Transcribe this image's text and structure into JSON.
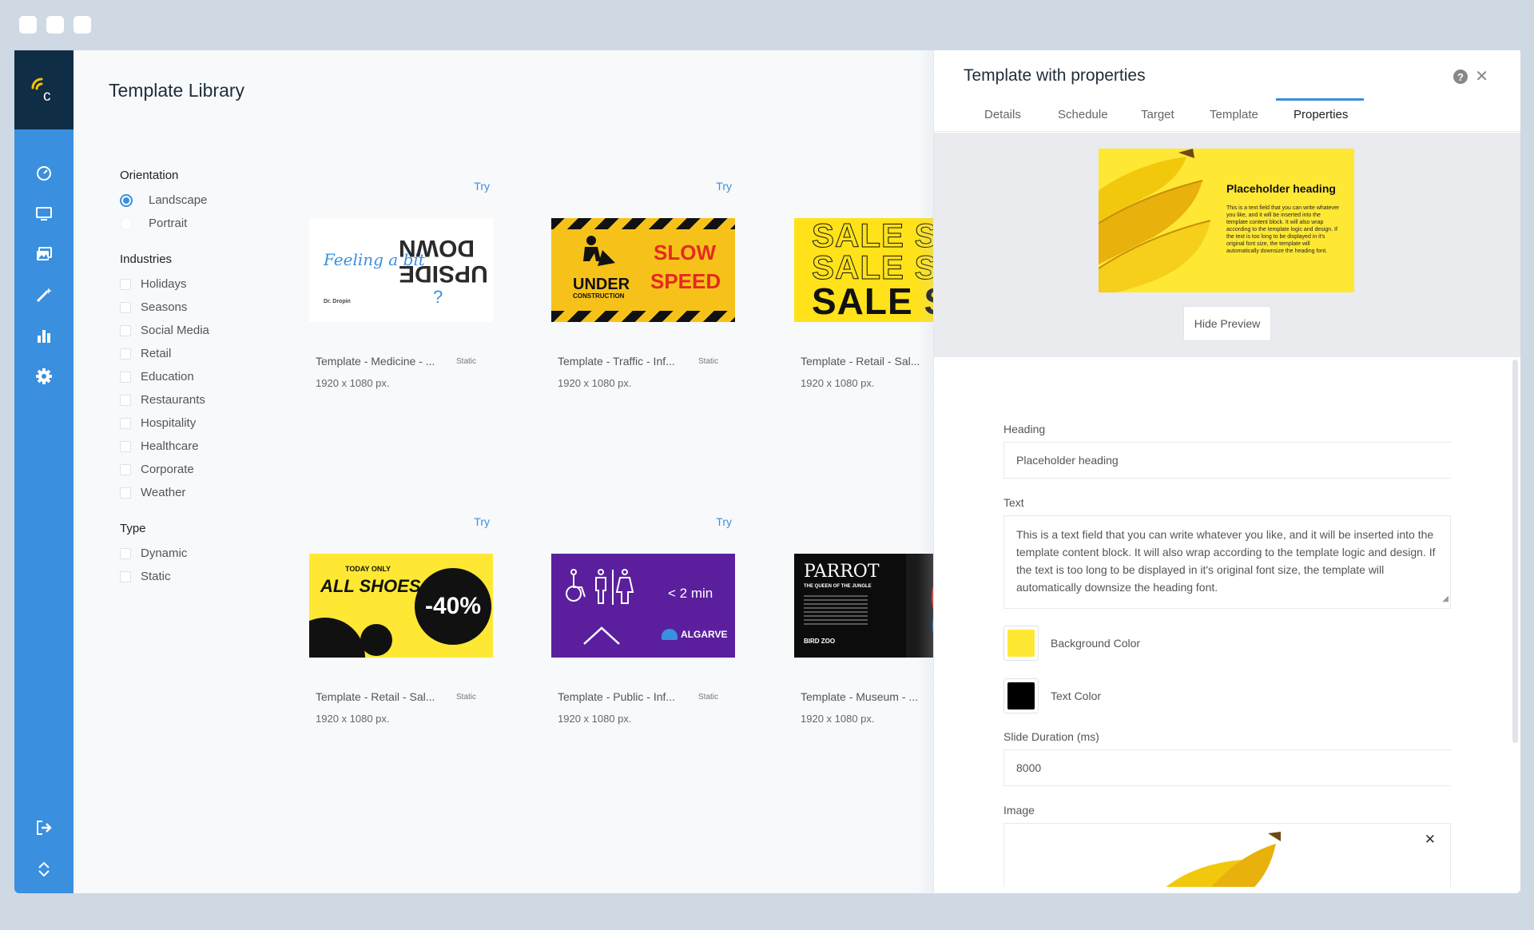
{
  "library": {
    "title": "Template Library",
    "filters": {
      "orientation": {
        "heading": "Orientation",
        "options": [
          "Landscape",
          "Portrait"
        ],
        "selected": "Landscape"
      },
      "industries": {
        "heading": "Industries",
        "options": [
          "Holidays",
          "Seasons",
          "Social Media",
          "Retail",
          "Education",
          "Restaurants",
          "Hospitality",
          "Healthcare",
          "Corporate",
          "Weather"
        ]
      },
      "type": {
        "heading": "Type",
        "options": [
          "Dynamic",
          "Static"
        ]
      }
    },
    "cards": [
      {
        "name": "Template - Medicine - ...",
        "badge": "Static",
        "size": "1920 x 1080 px.",
        "try": "Try",
        "thumb": {
          "left": "Feeling a bit",
          "right1": "DOWN",
          "right2": "UPSIDE",
          "q": "?",
          "brand": "Dr. Dropin"
        }
      },
      {
        "name": "Template - Traffic - Inf...",
        "badge": "Static",
        "size": "1920 x 1080 px.",
        "try": "Try",
        "thumb": {
          "under": "UNDER",
          "construction": "CONSTRUCTION",
          "slow": "SLOW",
          "speed": "SPEED"
        }
      },
      {
        "name": "Template - Retail - Sal...",
        "badge": "",
        "size": "1920 x 1080 px.",
        "try": "",
        "thumb": {
          "word": "SALE SAL"
        }
      },
      {
        "name": "Template - Retail - Sal...",
        "badge": "Static",
        "size": "1920 x 1080 px.",
        "try": "Try",
        "thumb": {
          "today": "TODAY ONLY",
          "shoes": "ALL SHOES",
          "pct": "-40%"
        }
      },
      {
        "name": "Template - Public - Inf...",
        "badge": "Static",
        "size": "1920 x 1080 px.",
        "try": "Try",
        "thumb": {
          "min": "< 2 min",
          "brand": "ALGARVE"
        }
      },
      {
        "name": "Template - Museum - ...",
        "badge": "",
        "size": "1920 x 1080 px.",
        "try": "",
        "thumb": {
          "title": "PARROT",
          "sub": "THE QUEEN OF THE JUNGLE",
          "brand": "BIRD ZOO"
        }
      }
    ]
  },
  "panel": {
    "title": "Template with properties",
    "tabs": [
      "Details",
      "Schedule",
      "Target",
      "Template",
      "Properties"
    ],
    "active_tab": "Properties",
    "preview": {
      "heading": "Placeholder heading",
      "text": "This is a text field that you can write whatever you like, and it will be inserted into the template content block. It will also wrap according to the template logic and design. If the text is too long to be displayed in it's original font size, the template will automatically downsize the heading font."
    },
    "hide_preview": "Hide Preview",
    "form": {
      "heading_label": "Heading",
      "heading_value": "Placeholder heading",
      "text_label": "Text",
      "text_value": "This is a text field that you can write whatever you like, and it will be inserted into the template content block. It will also wrap according to the template logic and design. If the text is too long to be displayed in it's original font size, the template will automatically downsize the heading font.",
      "bg_color_label": "Background Color",
      "bg_color": "#ffe834",
      "text_color_label": "Text Color",
      "text_color": "#000000",
      "duration_label": "Slide Duration (ms)",
      "duration_value": "8000",
      "image_label": "Image"
    }
  },
  "colors": {
    "sidebar": "#3a8fde",
    "logo_bg": "#0f2d45",
    "accent": "#3a8fde",
    "yellow": "#ffe834",
    "purple": "#5b1f9e"
  }
}
